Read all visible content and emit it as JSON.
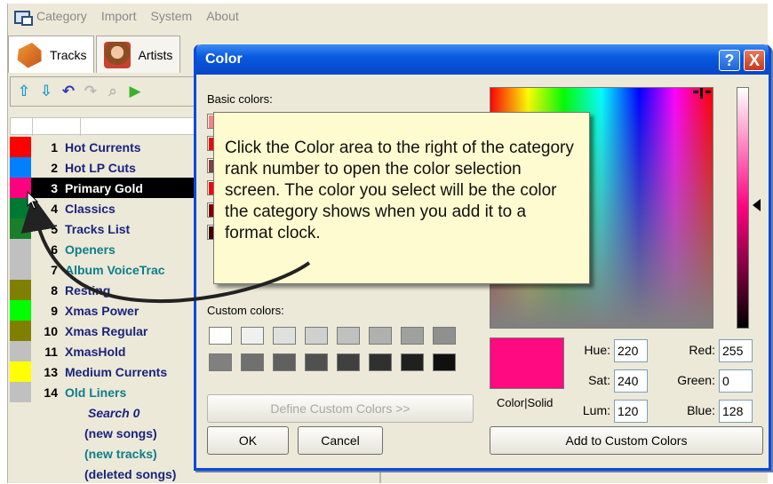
{
  "menu": {
    "items": [
      "Category",
      "Import",
      "System",
      "About"
    ]
  },
  "tabs": [
    {
      "label": "Tracks",
      "icon": "tracks-icon"
    },
    {
      "label": "Artists",
      "icon": "artist-icon"
    }
  ],
  "toolbar": {
    "buttons": [
      "move-up-icon",
      "move-down-icon",
      "undo-icon",
      "redo-icon",
      "find-icon",
      "play-icon"
    ]
  },
  "categories": [
    {
      "rank": "1",
      "name": "Hot Currents",
      "color": "#ff0000",
      "style": "navy"
    },
    {
      "rank": "2",
      "name": "Hot LP Cuts",
      "color": "#0080ff",
      "style": "navy"
    },
    {
      "rank": "3",
      "name": "Primary Gold",
      "color": "#ff0080",
      "style": "selected"
    },
    {
      "rank": "4",
      "name": "Classics",
      "color": "#007a33",
      "style": "navy"
    },
    {
      "rank": "5",
      "name": "Tracks List",
      "color": "#1a7f2a",
      "style": "navy"
    },
    {
      "rank": "6",
      "name": "Openers",
      "color": "#c0c0c0",
      "style": "teal"
    },
    {
      "rank": "7",
      "name": "Album VoiceTrac",
      "color": "#c0c0c0",
      "style": "teal"
    },
    {
      "rank": "8",
      "name": "Resting",
      "color": "#808000",
      "style": "navy"
    },
    {
      "rank": "9",
      "name": "Xmas Power",
      "color": "#00ff00",
      "style": "navy"
    },
    {
      "rank": "10",
      "name": "Xmas Regular",
      "color": "#808000",
      "style": "navy"
    },
    {
      "rank": "11",
      "name": "XmasHold",
      "color": "#c0c0c0",
      "style": "navy"
    },
    {
      "rank": "13",
      "name": "Medium Currents",
      "color": "#ffff00",
      "style": "navy"
    },
    {
      "rank": "14",
      "name": "Old Liners",
      "color": "#c0c0c0",
      "style": "teal"
    }
  ],
  "extra_rows": [
    {
      "text": "Search 0",
      "style": "italic"
    },
    {
      "text": "(new songs)",
      "style": "navy"
    },
    {
      "text": "(new tracks)",
      "style": "teal"
    },
    {
      "text": "(deleted songs)",
      "style": "navy"
    }
  ],
  "dialog": {
    "title": "Color",
    "help_label": "?",
    "close_label": "X",
    "basic_colors_label": "Basic colors:",
    "custom_colors_label": "Custom colors:",
    "define_custom_label": "Define Custom Colors >>",
    "ok_label": "OK",
    "cancel_label": "Cancel",
    "add_custom_label": "Add to Custom Colors",
    "color_solid_label": "Color|Solid",
    "preview_color": "#ff0a80",
    "fields": {
      "hue_label": "Hue:",
      "hue": "220",
      "sat_label": "Sat:",
      "sat": "240",
      "lum_label": "Lum:",
      "lum": "120",
      "red_label": "Red:",
      "red": "255",
      "green_label": "Green:",
      "green": "0",
      "blue_label": "Blue:",
      "blue": "128"
    },
    "basic_swatches_visible": [
      "#ff8080",
      "#ff0000",
      "#804040",
      "#ff0000",
      "#800000",
      "#400000"
    ],
    "custom_swatches": [
      "#ffffff",
      "#f0f0f0",
      "#e0e0e0",
      "#d0d0d0",
      "#c0c0c0",
      "#b0b0b0",
      "#a0a0a0",
      "#909090",
      "#808080",
      "#707070",
      "#606060",
      "#505050",
      "#404040",
      "#303030",
      "#202020",
      "#101010"
    ]
  },
  "callout": {
    "text": "Click the Color area to the right of the category rank number to open the color selection screen.  The color you select will be the color the category shows when you add it to a format clock."
  }
}
